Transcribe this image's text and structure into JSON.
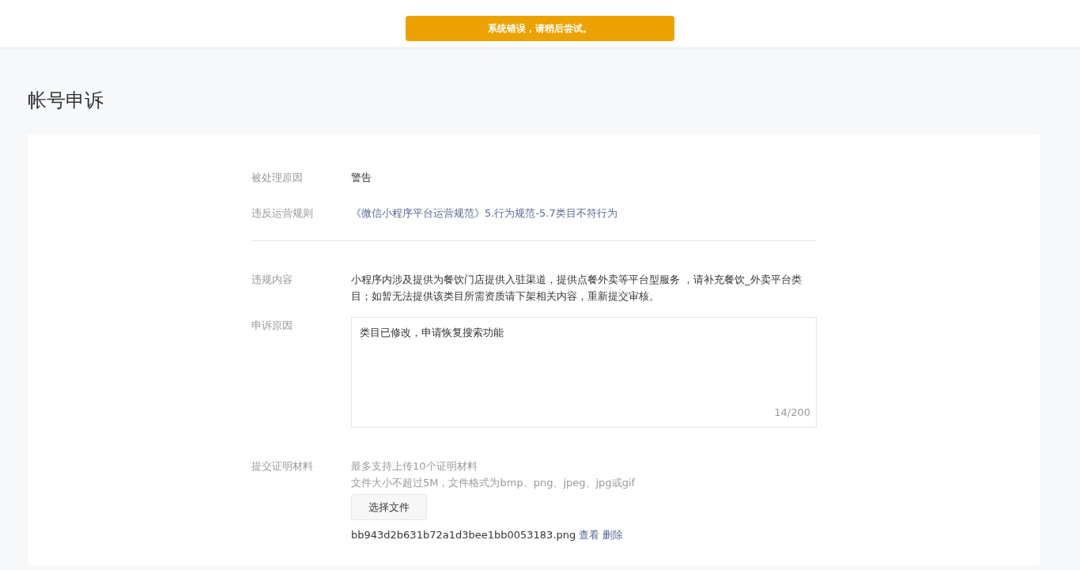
{
  "alert": {
    "text": "系统错误，请稍后尝试。"
  },
  "title": "帐号申诉",
  "info_rows": [
    {
      "label": "被处理原因",
      "value": "警告",
      "kind": "text"
    },
    {
      "label": "违反运营规则",
      "value": "《微信小程序平台运营规范》5.行为规范-5.7类目不符行为",
      "kind": "link"
    }
  ],
  "violation": {
    "label": "违规内容",
    "value": "小程序内涉及提供为餐饮门店提供入驻渠道，提供点餐外卖等平台型服务 ，请补充餐饮_外卖平台类目；如暂无法提供该类目所需资质请下架相关内容，重新提交审核。"
  },
  "appeal": {
    "label": "申诉原因",
    "value": "类目已修改，申请恢复搜索功能",
    "counter": "14/200"
  },
  "upload": {
    "label": "提交证明材料",
    "hints": [
      "最多支持上传10个证明材料",
      "文件大小不超过5M，文件格式为bmp、png、jpeg、jpg或gif"
    ],
    "button": "选择文件",
    "files": [
      {
        "name": "bb943d2b631b72a1d3bee1bb0053183.png",
        "actions": [
          "查看",
          "删除"
        ]
      }
    ]
  }
}
